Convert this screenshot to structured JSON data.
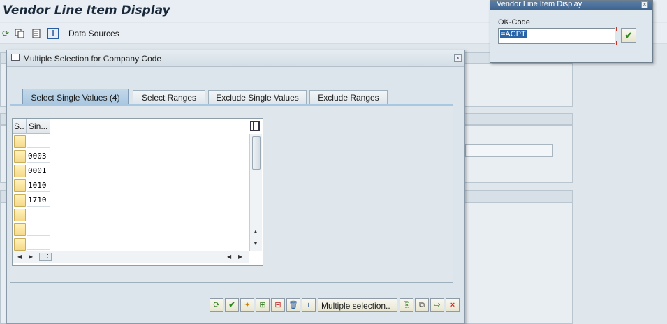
{
  "app": {
    "title": "Vendor Line Item Display"
  },
  "toolbar": {
    "data_sources_label": "Data Sources"
  },
  "dialog": {
    "title": "Multiple Selection for Company Code",
    "tabs": [
      {
        "label": "Select Single Values (4)"
      },
      {
        "label": "Select Ranges"
      },
      {
        "label": "Exclude Single Values"
      },
      {
        "label": "Exclude Ranges"
      }
    ],
    "grid": {
      "columns": [
        "S..",
        "Sin..."
      ],
      "rows": [
        "",
        "0003",
        "0001",
        "1010",
        "1710",
        "",
        "",
        ""
      ]
    },
    "buttons": {
      "multiple_selection_label": "Multiple selection.."
    }
  },
  "okcode_popup": {
    "title": "Vendor Line Item Display",
    "label": "OK-Code",
    "value": "=ACPT"
  },
  "icons": {
    "check": "✔",
    "info": "i",
    "close": "×"
  }
}
